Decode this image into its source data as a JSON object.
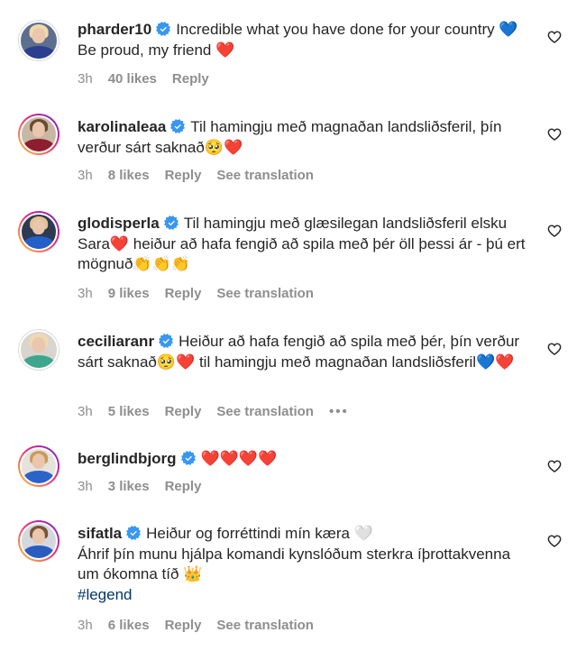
{
  "comments": [
    {
      "username": "pharder10",
      "text": "Incredible what you have done for your country 💙 Be proud, my friend ❤️",
      "time": "3h",
      "likes": "40 likes",
      "reply": "Reply",
      "translation": ""
    },
    {
      "username": "karolinaleaa",
      "text": "Til hamingju með magnaðan landsliðsferil, þín verður sárt saknað🥺❤️",
      "time": "3h",
      "likes": "8 likes",
      "reply": "Reply",
      "translation": "See translation"
    },
    {
      "username": "glodisperla",
      "text": "Til hamingju með glæsilegan landsliðsferil elsku Sara❤️ heiður að hafa fengið að spila með þér öll þessi ár - þú ert mögnuð👏👏👏",
      "time": "3h",
      "likes": "9 likes",
      "reply": "Reply",
      "translation": "See translation"
    },
    {
      "username": "ceciliaranr",
      "text": "Heiður að hafa fengið að spila með þér, þín verður sárt saknað🥺❤️ til hamingju með magnaðan landsliðsferil💙❤️",
      "time": "3h",
      "likes": "5 likes",
      "reply": "Reply",
      "translation": "See translation",
      "more": "•••"
    },
    {
      "username": "berglindbjorg",
      "text": "❤️❤️❤️❤️",
      "time": "3h",
      "likes": "3 likes",
      "reply": "Reply",
      "translation": ""
    },
    {
      "username": "sifatla",
      "text": "Heiður og forréttindi mín kæra 🤍",
      "text_line2": "Áhrif þín munu hjálpa komandi kynslóðum sterkra íþrottakvenna um ókomna tíð 👑",
      "hashtag": "#legend",
      "time": "3h",
      "likes": "6 likes",
      "reply": "Reply",
      "translation": "See translation"
    }
  ],
  "icons": {
    "verified": "verified-badge-icon",
    "like": "heart-outline-icon"
  },
  "colors": {
    "verified": "#3897f0",
    "meta": "#8e8e8e",
    "hashtag": "#00376b"
  }
}
